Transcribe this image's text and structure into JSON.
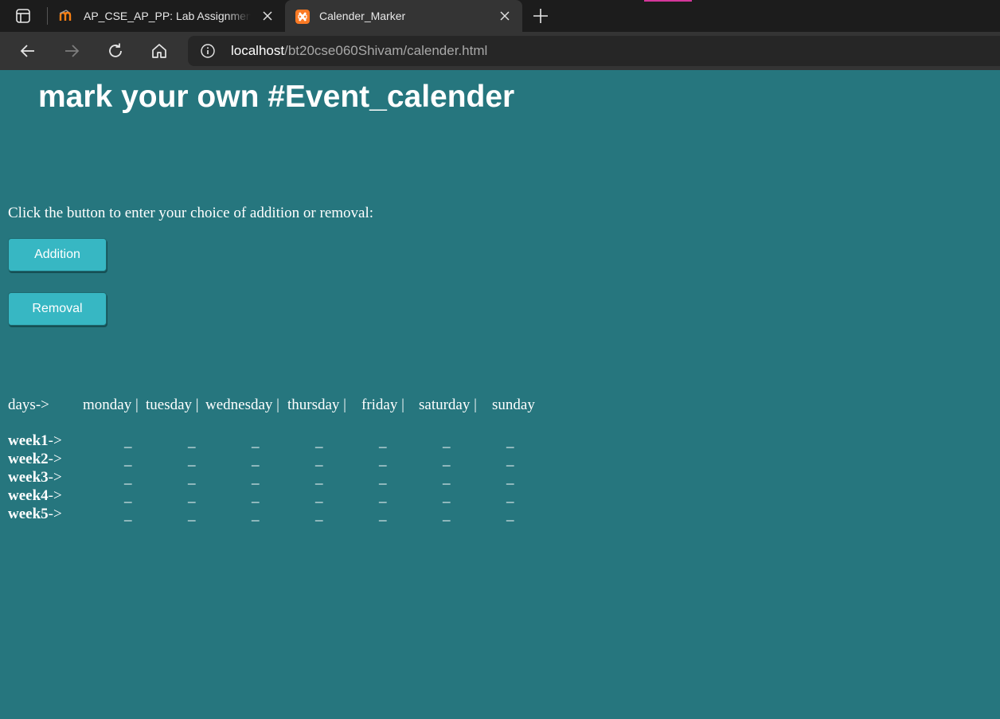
{
  "browser": {
    "tabs": [
      {
        "title": "AP_CSE_AP_PP: Lab Assignment",
        "favicon": "moodle-icon",
        "active": false
      },
      {
        "title": "Calender_Marker",
        "favicon": "xampp-icon",
        "active": true
      }
    ],
    "address": {
      "host": "localhost",
      "path": "/bt20cse060Shivam/calender.html"
    }
  },
  "page": {
    "heading": "mark your own #Event_calender",
    "prompt": "Click the button to enter your choice of addition or removal:",
    "buttons": {
      "addition": "Addition",
      "removal": "Removal"
    },
    "calendar": {
      "days_label": "days->",
      "days": [
        "monday |",
        "tuesday |",
        "wednesday |",
        "thursday |",
        "friday |",
        "saturday |",
        "sunday"
      ],
      "weeks": [
        {
          "name": "week1",
          "arrow": "->"
        },
        {
          "name": "week2",
          "arrow": "->"
        },
        {
          "name": "week3",
          "arrow": "->"
        },
        {
          "name": "week4",
          "arrow": "->"
        },
        {
          "name": "week5",
          "arrow": "->"
        }
      ],
      "cells": [
        [
          "_",
          "_",
          "_",
          "_",
          "_",
          "_",
          "_"
        ],
        [
          "_",
          "_",
          "_",
          "_",
          "_",
          "_",
          "_"
        ],
        [
          "_",
          "_",
          "_",
          "_",
          "_",
          "_",
          "_"
        ],
        [
          "_",
          "_",
          "_",
          "_",
          "_",
          "_",
          "_"
        ],
        [
          "_",
          "_",
          "_",
          "_",
          "_",
          "_",
          "_"
        ]
      ]
    }
  },
  "colors": {
    "page_bg": "#26767e",
    "button_bg": "#37b7c3",
    "tabbar_bg": "#1c1c1c",
    "toolbar_bg": "#343434"
  }
}
